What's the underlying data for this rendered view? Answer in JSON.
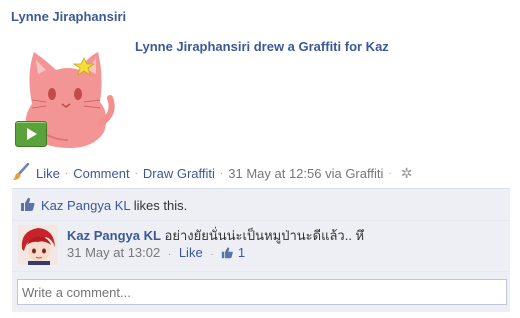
{
  "post": {
    "author": "Lynne Jiraphansiri",
    "headline": "Lynne Jiraphansiri drew a Graffiti for Kaz",
    "actions": {
      "like": "Like",
      "comment": "Comment",
      "draw": "Draw Graffiti",
      "timestamp": "31 May at 12:56 via Graffiti"
    }
  },
  "likes": {
    "names": "Kaz Pangya KL",
    "suffix": " likes this."
  },
  "comment": {
    "author": "Kaz Pangya KL",
    "text": " อย่างยัยนั่นน่ะเป็นหมูป่านะดีแล้ว.. หึ",
    "timestamp": "31 May at 13:02",
    "like_label": "Like",
    "like_count": "1"
  },
  "write_comment": {
    "placeholder": "Write a comment..."
  }
}
